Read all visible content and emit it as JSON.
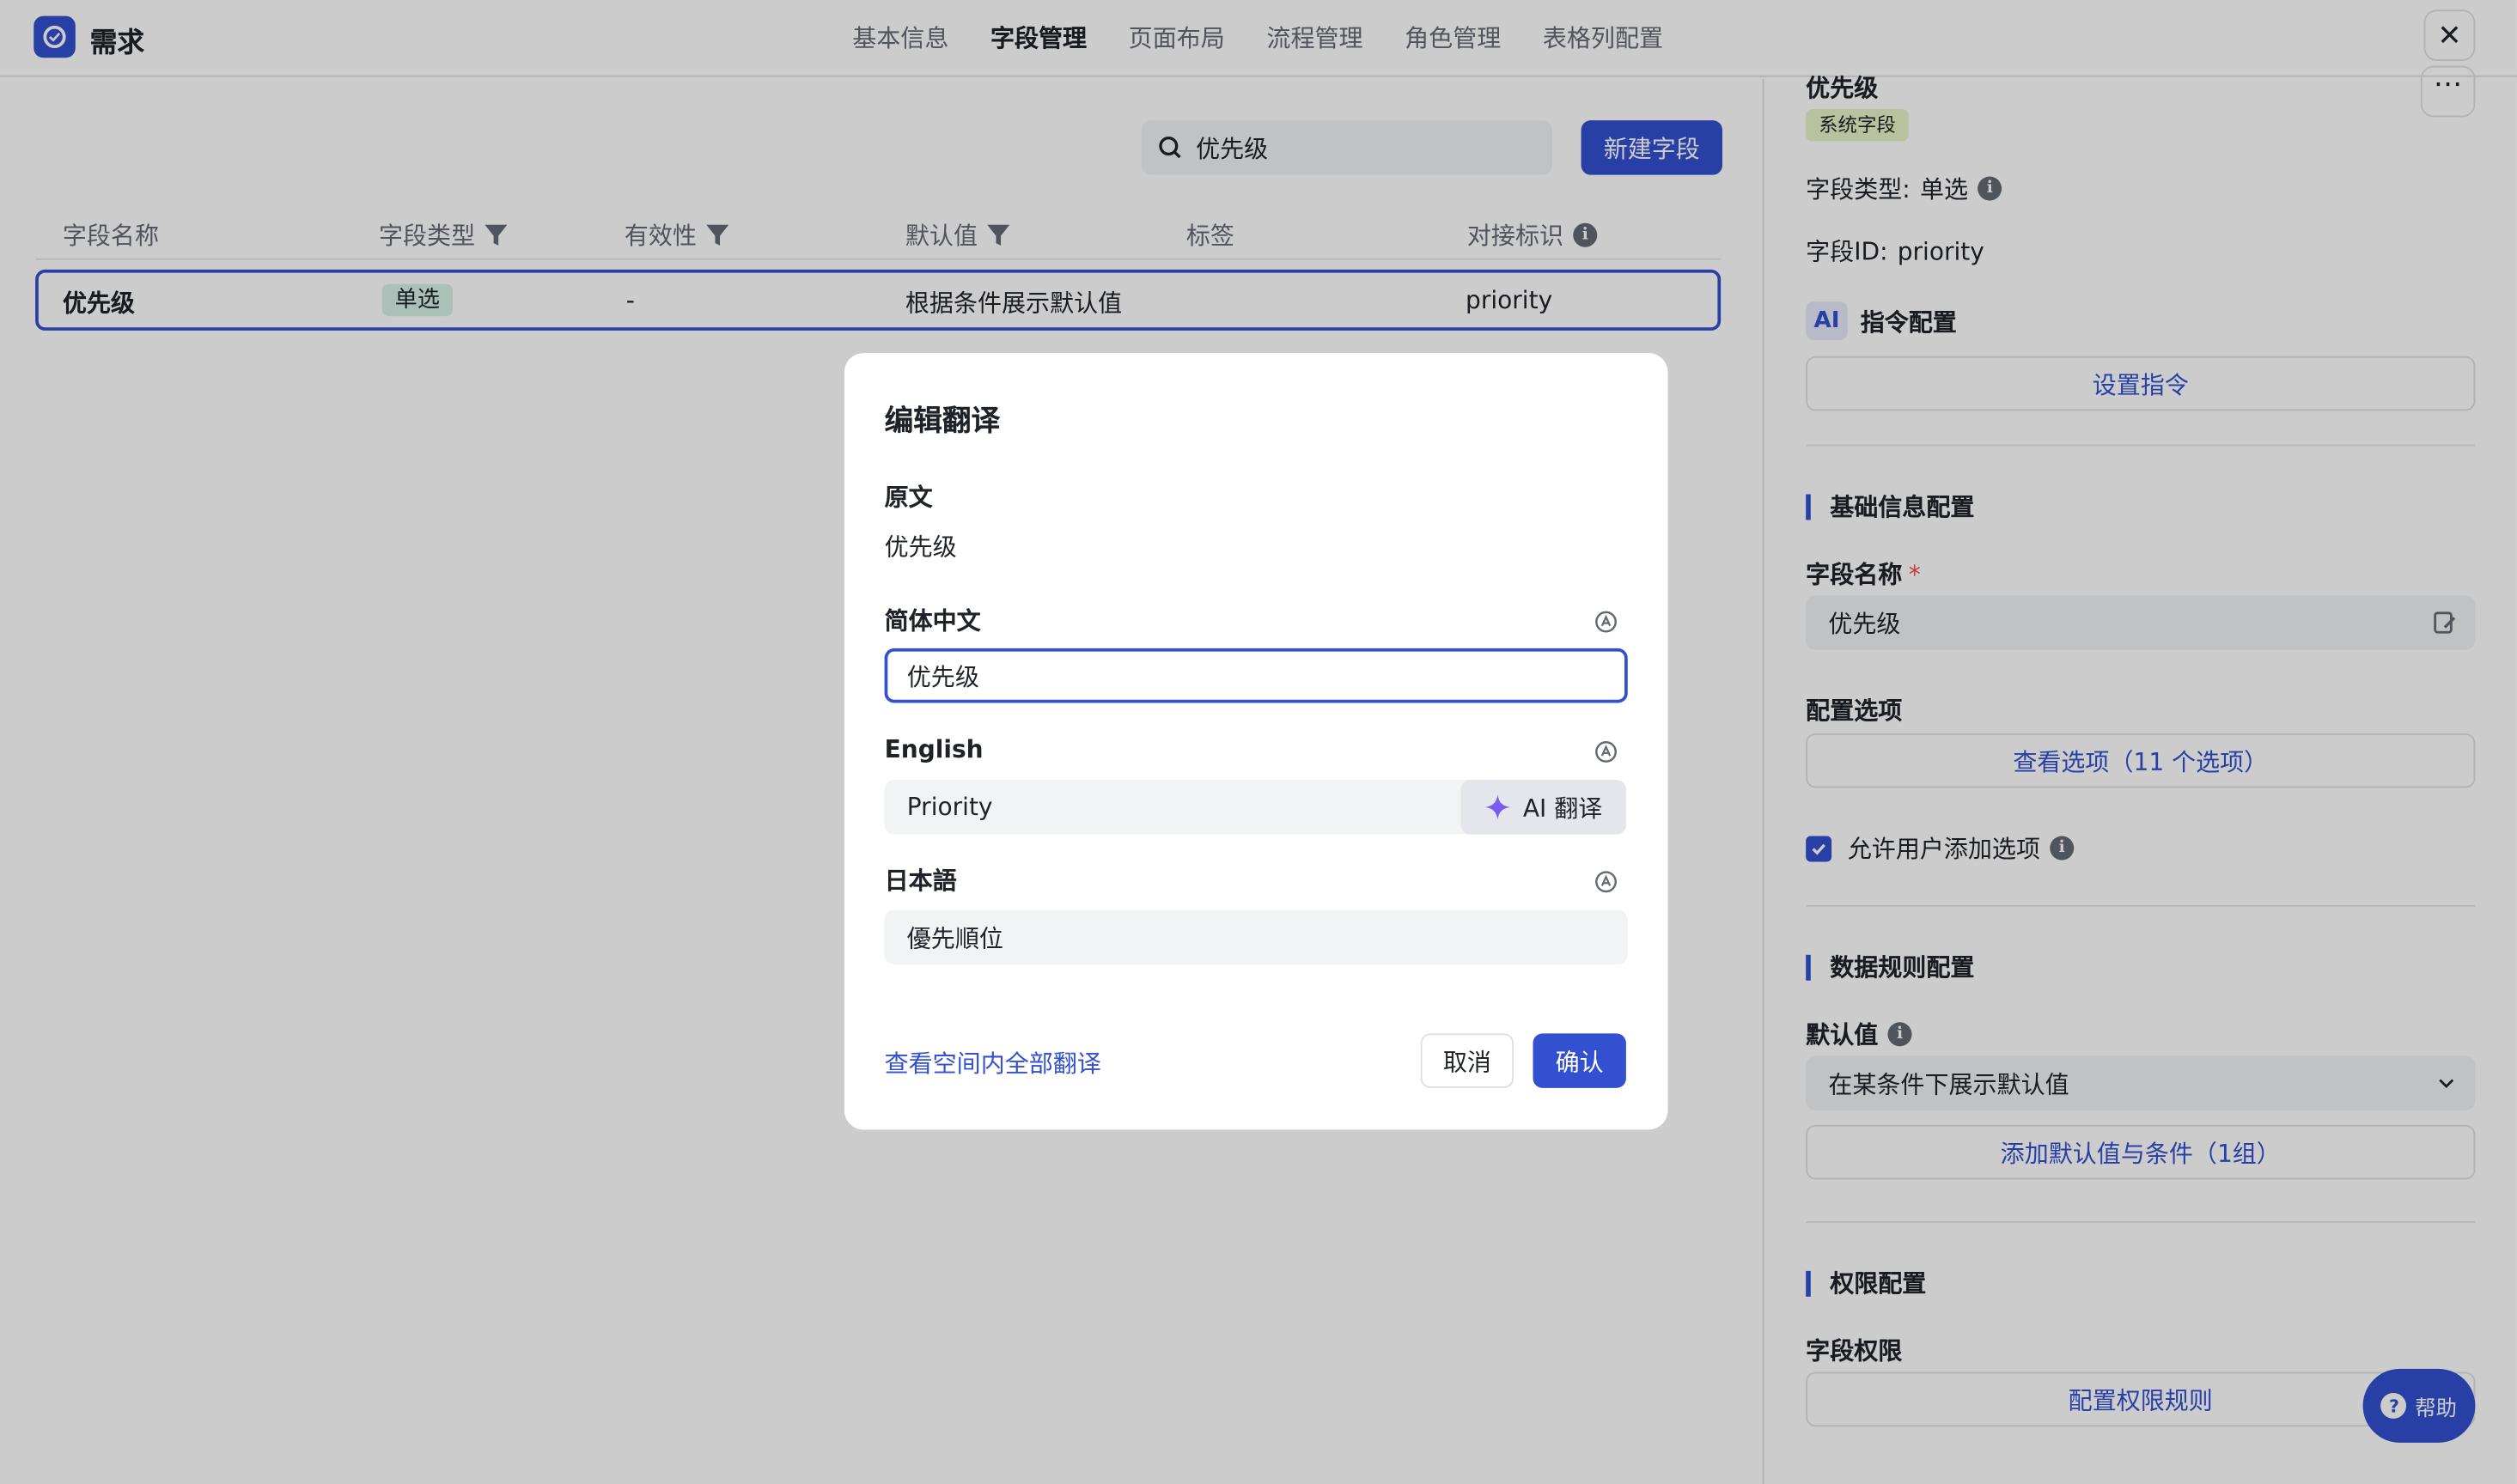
{
  "header": {
    "app_title": "需求",
    "tabs": [
      {
        "label": "基本信息",
        "active": false
      },
      {
        "label": "字段管理",
        "active": true
      },
      {
        "label": "页面布局",
        "active": false
      },
      {
        "label": "流程管理",
        "active": false
      },
      {
        "label": "角色管理",
        "active": false
      },
      {
        "label": "表格列配置",
        "active": false
      }
    ],
    "close_icon": "close-icon"
  },
  "toolbar": {
    "search_value": "优先级",
    "new_field_label": "新建字段"
  },
  "table": {
    "headers": [
      "字段名称",
      "字段类型",
      "有效性",
      "默认值",
      "标签",
      "对接标识"
    ],
    "rows": [
      {
        "name": "优先级",
        "type": "单选",
        "validity": "-",
        "default": "根据条件展示默认值",
        "tag": "",
        "key": "priority"
      }
    ]
  },
  "detail": {
    "title": "优先级",
    "system_tag": "系统字段",
    "type_label": "字段类型:",
    "type_value": "单选",
    "id_label": "字段ID:",
    "id_value": "priority",
    "ai_badge": "AI",
    "ai_config_label": "指令配置",
    "set_instruction": "设置指令",
    "basic_section": "基础信息配置",
    "field_name_label": "字段名称",
    "required_mark": "*",
    "field_name_value": "优先级",
    "options_label": "配置选项",
    "view_options": "查看选项（11 个选项）",
    "allow_add_options": "允许用户添加选项",
    "data_rule_section": "数据规则配置",
    "default_label": "默认值",
    "default_value": "在某条件下展示默认值",
    "add_default": "添加默认值与条件（1组）",
    "permission_section": "权限配置",
    "field_permission_label": "字段权限",
    "config_permission": "配置权限规则"
  },
  "help": {
    "label": "帮助"
  },
  "modal": {
    "title": "编辑翻译",
    "original_label": "原文",
    "original_value": "优先级",
    "zh_label": "简体中文",
    "zh_value": "优先级",
    "en_label": "English",
    "en_value": "Priority",
    "ai_translate": "AI 翻译",
    "ja_label": "日本語",
    "ja_value": "優先順位",
    "view_all_link": "查看空间内全部翻译",
    "cancel": "取消",
    "confirm": "确认"
  },
  "colors": {
    "accent": "#3250d0",
    "option_chip": "#d6f0e4",
    "system_tag": "#e8f3c6",
    "ai_sparkle": "#7b5cf0"
  }
}
